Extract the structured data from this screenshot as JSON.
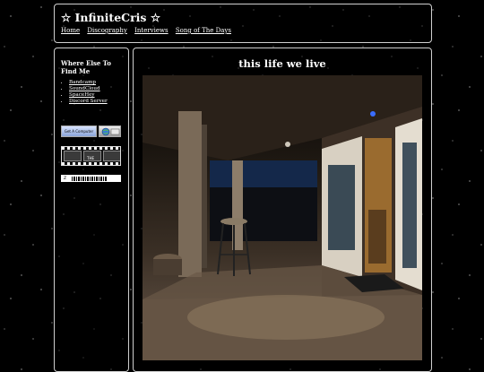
{
  "header": {
    "title": "☆ InfiniteCris ☆",
    "nav": [
      "Home",
      "Discography",
      "Interviews",
      "Song of The Days"
    ]
  },
  "sidebar": {
    "heading": "Where Else To Find Me",
    "links": [
      "Bandcamp",
      "SoundCloud",
      "SpaceHey",
      "Discord Server"
    ],
    "badges": {
      "get_computer": "Get A Computer",
      "film": "THE",
      "bar": "Z"
    }
  },
  "main": {
    "title": "this life we live"
  }
}
